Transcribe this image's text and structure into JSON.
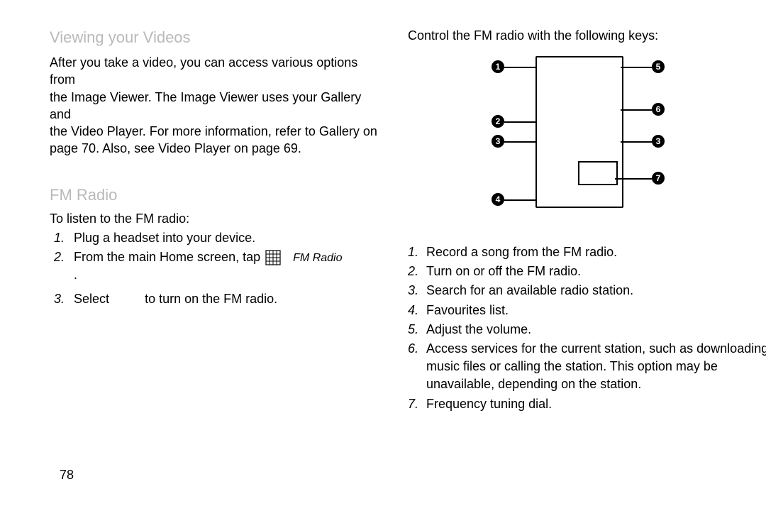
{
  "left": {
    "section1_title": "Viewing your Videos",
    "para1_l1": "After you take a video, you can access various options from",
    "para1_l2": "the Image Viewer. The Image Viewer uses your Gallery and",
    "para1_l3": "the Video Player. For more information, refer to Gallery on",
    "para1_l4": "page 70. Also, see Video Player on page 69.",
    "section2_title": "FM Radio",
    "intro": "To listen to the FM radio:",
    "steps": {
      "n1": "1.",
      "s1": "Plug a headset into your device.",
      "n2": "2.",
      "s2a": "From the main Home screen, tap",
      "s2b": "FM Radio",
      "s2dot": ".",
      "n3": "3.",
      "s3a": "Select",
      "s3b": "to turn on the FM radio."
    }
  },
  "right": {
    "intro": "Control the FM radio with the following keys:",
    "labels": {
      "b1": "1",
      "b2": "2",
      "b3a": "3",
      "b3b": "3",
      "b4": "4",
      "b5": "5",
      "b6": "6",
      "b7": "7"
    },
    "keys": {
      "n1": "1.",
      "t1": "Record a song from the FM radio.",
      "n2": "2.",
      "t2": "Turn on or off the FM radio.",
      "n3": "3.",
      "t3": "Search for an available radio station.",
      "n4": "4.",
      "t4": "Favourites list.",
      "n5": "5.",
      "t5": "Adjust the volume.",
      "n6": "6.",
      "t6": "Access services for the current station, such as downloading music files or calling the station. This option may be unavailable, depending on the station.",
      "n7": "7.",
      "t7": "Frequency tuning dial."
    }
  },
  "page_number": "78"
}
